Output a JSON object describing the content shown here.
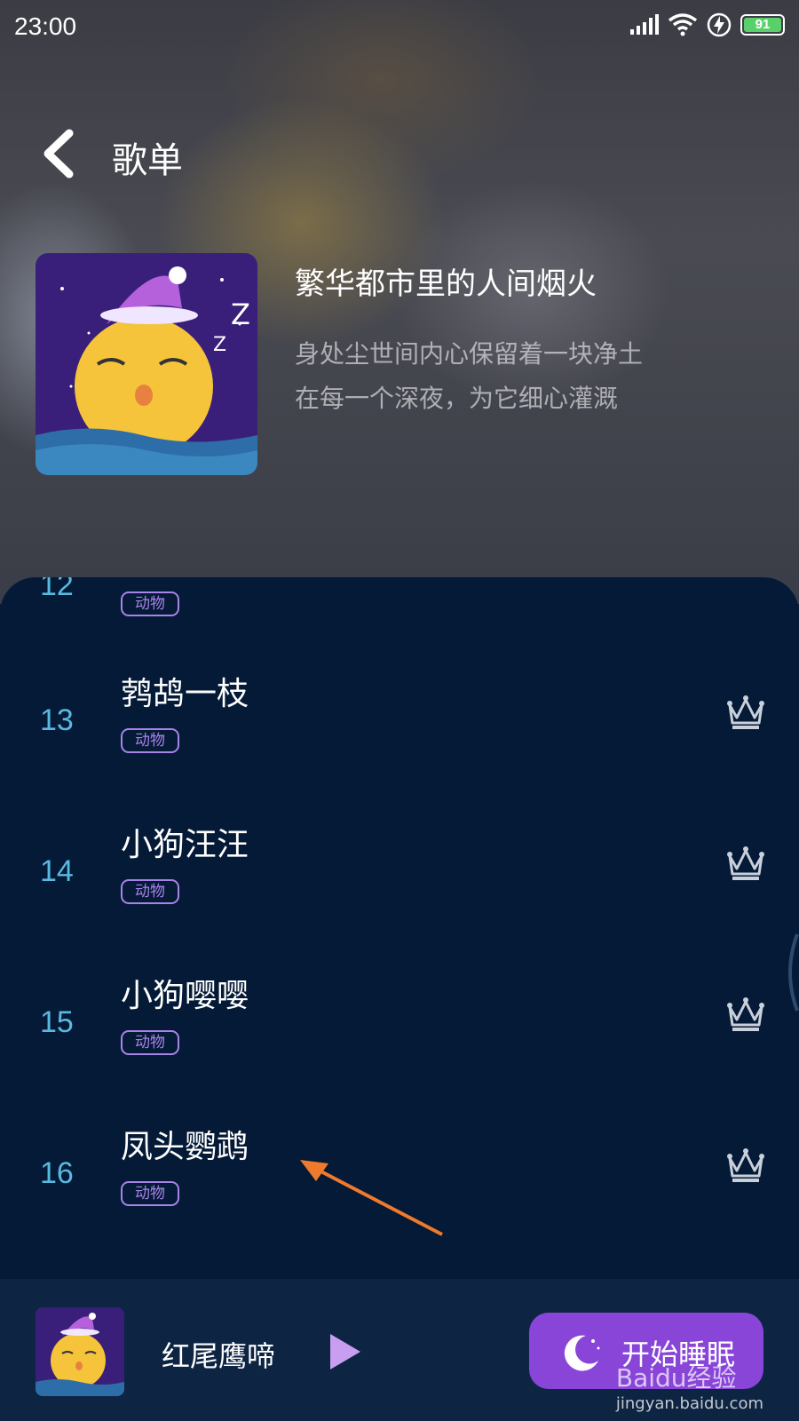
{
  "status_bar": {
    "time": "23:00",
    "battery": "91"
  },
  "header": {
    "title": "歌单"
  },
  "playlist": {
    "title": "繁华都市里的人间烟火",
    "description_line1": "身处尘世间内心保留着一块净土",
    "description_line2": "在每一个深夜，为它细心灌溉"
  },
  "tracks": [
    {
      "number": "12",
      "name": "",
      "tag": "动物"
    },
    {
      "number": "13",
      "name": "鹁鸪一枝",
      "tag": "动物"
    },
    {
      "number": "14",
      "name": "小狗汪汪",
      "tag": "动物"
    },
    {
      "number": "15",
      "name": "小狗嘤嘤",
      "tag": "动物"
    },
    {
      "number": "16",
      "name": "凤头鹦鹉",
      "tag": "动物"
    }
  ],
  "player": {
    "now_playing": "红尾鹰啼",
    "sleep_button": "开始睡眠"
  },
  "watermark": {
    "line1": "Baidu经验",
    "line2": "jingyan.baidu.com"
  },
  "colors": {
    "accent": "#8845d8",
    "tag": "#a883e8",
    "number": "#5ab9e0",
    "panel": "#041a36"
  }
}
